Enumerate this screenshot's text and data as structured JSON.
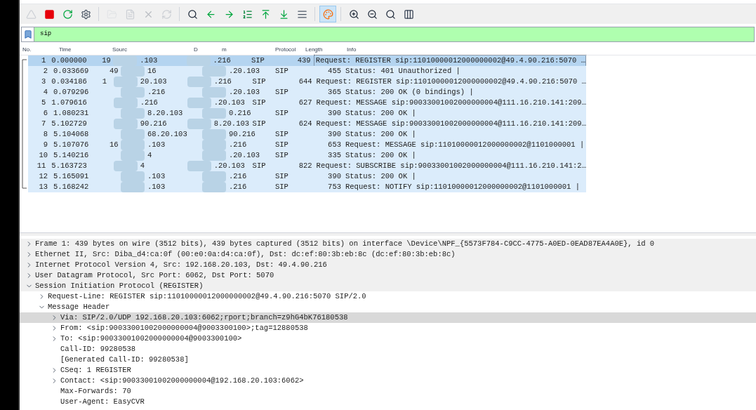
{
  "toolbar": [
    {
      "kind": "fin",
      "disabled": true,
      "pressed": false
    },
    {
      "kind": "stop",
      "disabled": false,
      "pressed": false
    },
    {
      "kind": "restart",
      "disabled": false,
      "pressed": false
    },
    {
      "kind": "options",
      "disabled": false,
      "pressed": false
    },
    {
      "kind": "sep"
    },
    {
      "kind": "open",
      "disabled": true,
      "pressed": false
    },
    {
      "kind": "save",
      "disabled": true,
      "pressed": false
    },
    {
      "kind": "close",
      "disabled": true,
      "pressed": false
    },
    {
      "kind": "reload",
      "disabled": true,
      "pressed": false
    },
    {
      "kind": "sep"
    },
    {
      "kind": "find",
      "disabled": false,
      "pressed": false
    },
    {
      "kind": "back",
      "disabled": false,
      "pressed": false
    },
    {
      "kind": "forward",
      "disabled": false,
      "pressed": false
    },
    {
      "kind": "goto",
      "disabled": false,
      "pressed": false
    },
    {
      "kind": "first",
      "disabled": false,
      "pressed": false
    },
    {
      "kind": "last",
      "disabled": false,
      "pressed": false
    },
    {
      "kind": "autoscroll",
      "disabled": false,
      "pressed": false
    },
    {
      "kind": "sep"
    },
    {
      "kind": "colorize",
      "disabled": false,
      "pressed": true
    },
    {
      "kind": "sep"
    },
    {
      "kind": "zoomin",
      "disabled": false,
      "pressed": false
    },
    {
      "kind": "zoomout",
      "disabled": false,
      "pressed": false
    },
    {
      "kind": "zoomreset",
      "disabled": false,
      "pressed": false
    },
    {
      "kind": "resize",
      "disabled": false,
      "pressed": false
    }
  ],
  "filter": {
    "value": "sip"
  },
  "packet_list": {
    "columns": [
      "No.",
      "Time",
      "Sourc",
      "D",
      "m",
      "Protocol",
      "Length",
      "Info"
    ],
    "rows": [
      {
        "no": "1",
        "time": "0.000000",
        "source_parts": [
          "19",
          ".103"
        ],
        "destination_parts": [
          ".216"
        ],
        "protocol": "SIP",
        "length": "439",
        "info": "Request: REGISTER sip:11010000012000000002@49.4.90.216:5070 …",
        "selected": true
      },
      {
        "no": "2",
        "time": "0.033669",
        "source_parts": [
          "49",
          "16"
        ],
        "destination_parts": [
          ".20.103"
        ],
        "protocol": "SIP",
        "length": "455",
        "info": "Status: 401 Unauthorized |",
        "selected": false
      },
      {
        "no": "3",
        "time": "0.034186",
        "source_parts": [
          "1",
          "20.103"
        ],
        "destination_parts": [
          ".216"
        ],
        "protocol": "SIP",
        "length": "644",
        "info": "Request: REGISTER sip:11010000012000000002@49.4.90.216:5070 …",
        "selected": false
      },
      {
        "no": "4",
        "time": "0.079296",
        "source_parts": [
          ".216"
        ],
        "destination_parts": [
          ".20.103"
        ],
        "protocol": "SIP",
        "length": "365",
        "info": "Status: 200 OK  (0 bindings) |",
        "selected": false
      },
      {
        "no": "5",
        "time": "1.079616",
        "source_parts": [
          ".216"
        ],
        "destination_parts": [
          ".20.103"
        ],
        "protocol": "SIP",
        "length": "627",
        "info": "Request: MESSAGE sip:90033001002000000004@111.16.210.141:209…",
        "selected": false
      },
      {
        "no": "6",
        "time": "1.080231",
        "source_parts": [
          "8.20.103"
        ],
        "destination_parts": [
          "0.216"
        ],
        "protocol": "SIP",
        "length": "390",
        "info": "Status: 200 OK |",
        "selected": false
      },
      {
        "no": "7",
        "time": "5.102729",
        "source_parts": [
          "90.216"
        ],
        "destination_parts": [
          "8.20.103"
        ],
        "protocol": "SIP",
        "length": "624",
        "info": "Request: MESSAGE sip:90033001002000000004@111.16.210.141:209…",
        "selected": false
      },
      {
        "no": "8",
        "time": "5.104068",
        "source_parts": [
          "68.20.103"
        ],
        "destination_parts": [
          "90.216"
        ],
        "protocol": "SIP",
        "length": "390",
        "info": "Status: 200 OK |",
        "selected": false
      },
      {
        "no": "9",
        "time": "5.107076",
        "source_parts": [
          "16",
          ".103"
        ],
        "destination_parts": [
          ".216"
        ],
        "protocol": "SIP",
        "length": "653",
        "info": "Request: MESSAGE sip:11010000012000000002@1101000001 |",
        "selected": false
      },
      {
        "no": "10",
        "time": "5.140216",
        "source_parts": [
          "4"
        ],
        "destination_parts": [
          ".20.103"
        ],
        "protocol": "SIP",
        "length": "335",
        "info": "Status: 200 OK |",
        "selected": false
      },
      {
        "no": "11",
        "time": "5.163723",
        "source_parts": [
          "4"
        ],
        "destination_parts": [
          ".20.103"
        ],
        "protocol": "SIP",
        "length": "822",
        "info": "Request: SUBSCRIBE sip:90033001002000000004@111.16.210.141:2…",
        "selected": false
      },
      {
        "no": "12",
        "time": "5.165091",
        "source_parts": [
          ".103"
        ],
        "destination_parts": [
          ".216"
        ],
        "protocol": "SIP",
        "length": "390",
        "info": "Status: 200 OK |",
        "selected": false
      },
      {
        "no": "13",
        "time": "5.168242",
        "source_parts": [
          ".103"
        ],
        "destination_parts": [
          ".216"
        ],
        "protocol": "SIP",
        "length": "753",
        "info": "Request: NOTIFY sip:11010000012000000002@1101000001 |",
        "selected": false
      }
    ]
  },
  "details": [
    {
      "text": "Frame 1: 439 bytes on wire (3512 bits), 439 bytes captured (3512 bits) on interface \\Device\\NPF_{5573F784-C9CC-4775-A0ED-0EAD87EA4A0E}, id 0",
      "kind": "branch",
      "expanded": false,
      "selected": false
    },
    {
      "text": "Ethernet II, Src: Diba_d4:ca:0f (00:e0:0a:d4:ca:0f), Dst: dc:ef:80:3b:eb:8c (dc:ef:80:3b:eb:8c)",
      "kind": "branch",
      "expanded": false,
      "selected": false
    },
    {
      "text": "Internet Protocol Version 4, Src: 192.168.20.103, Dst: 49.4.90.216",
      "kind": "branch",
      "expanded": false,
      "selected": false
    },
    {
      "text": "User Datagram Protocol, Src Port: 6062, Dst Port: 5070",
      "kind": "branch",
      "expanded": false,
      "selected": false
    },
    {
      "text": "Session Initiation Protocol (REGISTER)",
      "kind": "branch",
      "expanded": true,
      "selected": false,
      "children": [
        {
          "text": "Request-Line: REGISTER sip:11010000012000000002@49.4.90.216:5070 SIP/2.0",
          "kind": "branch",
          "expanded": false,
          "selected": false
        },
        {
          "text": "Message Header",
          "kind": "branch",
          "expanded": true,
          "selected": false,
          "children": [
            {
              "text": "Via: SIP/2.0/UDP 192.168.20.103:6062;rport;branch=z9hG4bK76180538",
              "kind": "branch",
              "expanded": false,
              "selected": true
            },
            {
              "text": "From: <sip:90033001002000000004@9003300100>;tag=12880538",
              "kind": "branch",
              "expanded": false,
              "selected": false
            },
            {
              "text": "To: <sip:90033001002000000004@9003300100>",
              "kind": "branch",
              "expanded": false,
              "selected": false
            },
            {
              "text": "Call-ID: 99280538",
              "kind": "leaf",
              "selected": false
            },
            {
              "text": "[Generated Call-ID: 99280538]",
              "kind": "leaf",
              "selected": false
            },
            {
              "text": "CSeq: 1 REGISTER",
              "kind": "branch",
              "expanded": false,
              "selected": false
            },
            {
              "text": "Contact: <sip:90033001002000000004@192.168.20.103:6062>",
              "kind": "branch",
              "expanded": false,
              "selected": false
            },
            {
              "text": "Max-Forwards: 70",
              "kind": "leaf",
              "selected": false
            },
            {
              "text": "User-Agent: EasyCVR",
              "kind": "leaf",
              "selected": false
            }
          ]
        }
      ]
    }
  ]
}
